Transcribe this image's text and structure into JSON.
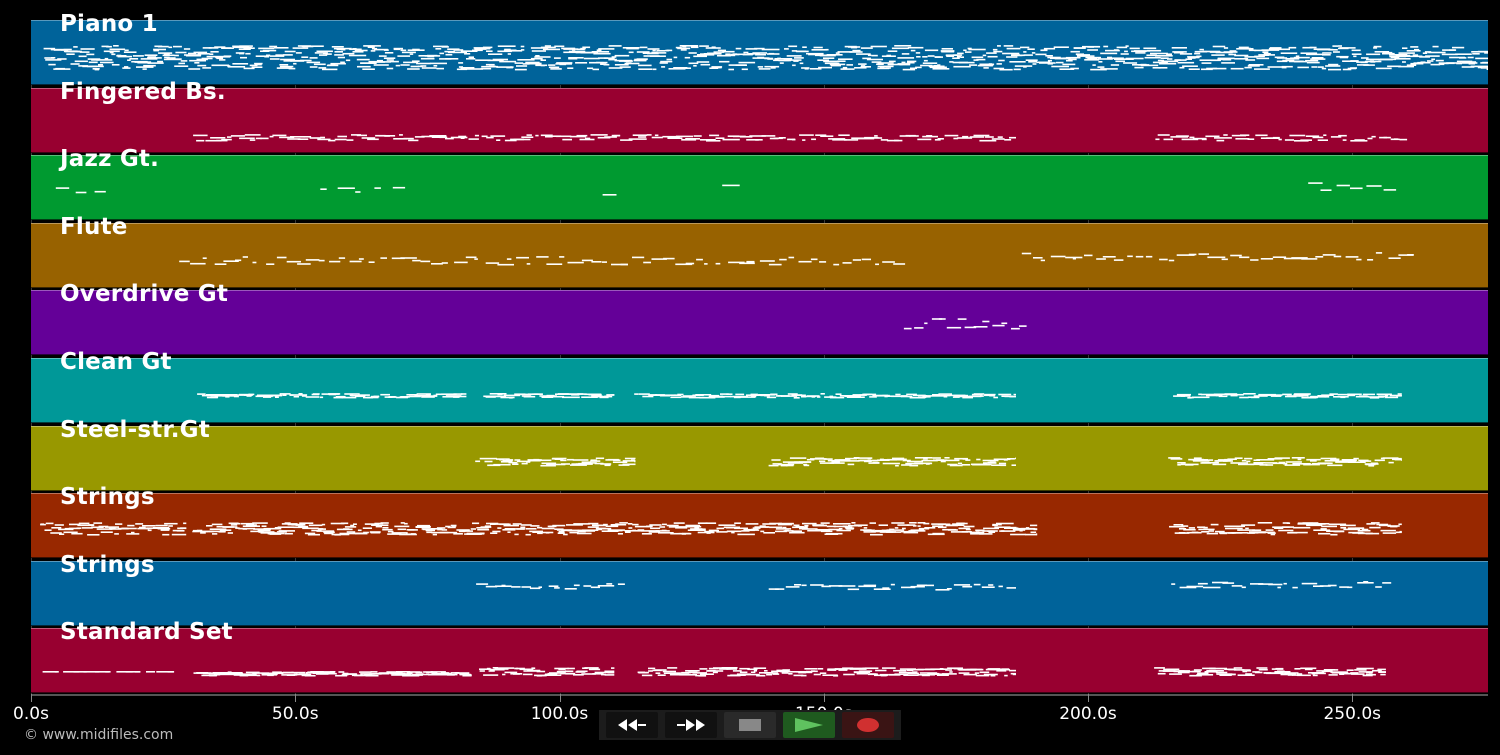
{
  "tracks": [
    {
      "name": "Piano 1",
      "color": "#00639a"
    },
    {
      "name": "Fingered Bs.",
      "color": "#980030"
    },
    {
      "name": "Jazz Gt.",
      "color": "#009a30"
    },
    {
      "name": "Flute",
      "color": "#986200"
    },
    {
      "name": "Overdrive Gt",
      "color": "#640098"
    },
    {
      "name": "Clean Gt",
      "color": "#009898"
    },
    {
      "name": "Steel-str.Gt",
      "color": "#989800"
    },
    {
      "name": "Strings",
      "color": "#982800"
    },
    {
      "name": "Strings",
      "color": "#00639a"
    },
    {
      "name": "Standard Set",
      "color": "#980030"
    }
  ],
  "timeline": {
    "ticks": [
      "0.0s",
      "50.0s",
      "100.0s",
      "150.0s",
      "200.0s",
      "250.0s"
    ]
  },
  "copyright": "© www.midifiles.com",
  "controls": {
    "rewind": "rewind-icon",
    "forward": "fast-forward-icon",
    "stop": "stop-icon",
    "play": "play-icon",
    "record": "record-icon",
    "stop_color": "#888888",
    "play_bg": "#1f5a1f",
    "play_color": "#5fc25f",
    "record_bg": "#3a1414",
    "record_color": "#d03030"
  }
}
